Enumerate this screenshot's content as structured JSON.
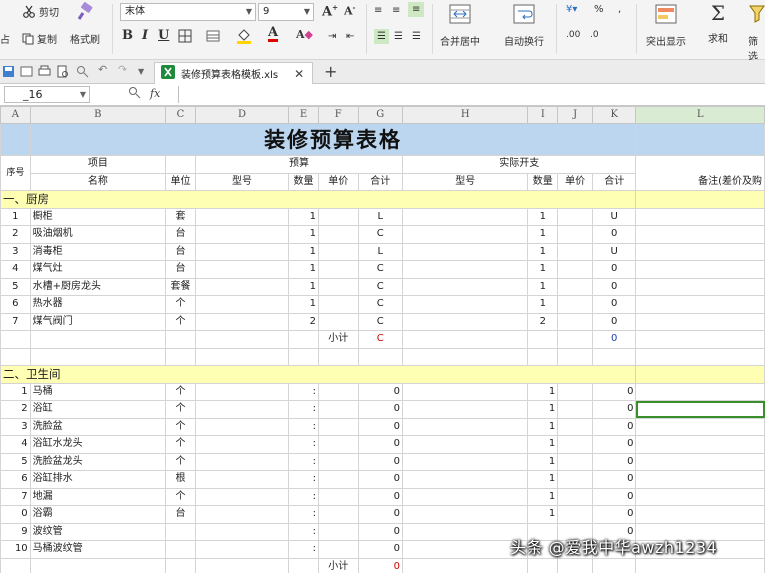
{
  "ribbon": {
    "cut": "剪切",
    "copy": "复制",
    "format_painter": "格式刷",
    "font_name": "末体",
    "font_size": "9",
    "merge_center": "合并居中",
    "wrap_text": "自动换行",
    "highlight": "突出显示",
    "sum": "求和",
    "filter": "筛选",
    "percent": "%"
  },
  "doc_tab": {
    "filename": "装修预算表格模板.xls"
  },
  "formula_bar": {
    "name_box": "_16",
    "fx": "fx"
  },
  "columns": [
    "A",
    "B",
    "C",
    "D",
    "E",
    "F",
    "G",
    "H",
    "I",
    "J",
    "K",
    "L"
  ],
  "sheet": {
    "title": "装修预算表格",
    "header": {
      "index": "序号",
      "item": "项目",
      "item_name": "名称",
      "unit": "单位",
      "budget": "预算",
      "model": "型号",
      "quantity": "数量",
      "unit_price": "单价",
      "total": "合计",
      "actual": "实际开支",
      "actual_model": "型号",
      "actual_qty": "数量",
      "actual_price": "单价",
      "actual_total": "合计",
      "note": "备注(差价及购"
    },
    "section1": {
      "label": "一、厨房",
      "rows": [
        {
          "no": "1",
          "name": "橱柜",
          "unit": "套",
          "qty": "1",
          "total": "L",
          "aqty": "1",
          "atotal": "U"
        },
        {
          "no": "2",
          "name": "吸油烟机",
          "unit": "台",
          "qty": "1",
          "total": "C",
          "aqty": "1",
          "atotal": "0"
        },
        {
          "no": "3",
          "name": "消毒柜",
          "unit": "台",
          "qty": "1",
          "total": "L",
          "aqty": "1",
          "atotal": "U"
        },
        {
          "no": "4",
          "name": "煤气灶",
          "unit": "台",
          "qty": "1",
          "total": "C",
          "aqty": "1",
          "atotal": "0"
        },
        {
          "no": "5",
          "name": "水槽+厨房龙头",
          "unit": "套餐",
          "qty": "1",
          "total": "C",
          "aqty": "1",
          "atotal": "0"
        },
        {
          "no": "6",
          "name": "热水器",
          "unit": "个",
          "qty": "1",
          "total": "C",
          "aqty": "1",
          "atotal": "0"
        },
        {
          "no": "7",
          "name": "煤气阀门",
          "unit": "个",
          "qty": "2",
          "total": "C",
          "aqty": "2",
          "atotal": "0"
        }
      ],
      "subtotal_label": "小计",
      "subtotal_total": "C",
      "subtotal_actual": "0"
    },
    "section2": {
      "label": "二、卫生间",
      "rows": [
        {
          "no": "1",
          "name": "马桶",
          "unit": "个",
          "qty": ":",
          "total": "0",
          "aqty": "1",
          "atotal": "0"
        },
        {
          "no": "2",
          "name": "浴缸",
          "unit": "个",
          "qty": ":",
          "total": "0",
          "aqty": "1",
          "atotal": "0"
        },
        {
          "no": "3",
          "name": "洗脸盆",
          "unit": "个",
          "qty": ":",
          "total": "0",
          "aqty": "1",
          "atotal": "0"
        },
        {
          "no": "4",
          "name": "浴缸水龙头",
          "unit": "个",
          "qty": ":",
          "total": "0",
          "aqty": "1",
          "atotal": "0"
        },
        {
          "no": "5",
          "name": "洗脸盆龙头",
          "unit": "个",
          "qty": ":",
          "total": "0",
          "aqty": "1",
          "atotal": "0"
        },
        {
          "no": "6",
          "name": "浴缸排水",
          "unit": "根",
          "qty": ":",
          "total": "0",
          "aqty": "1",
          "atotal": "0"
        },
        {
          "no": "7",
          "name": "地漏",
          "unit": "个",
          "qty": ":",
          "total": "0",
          "aqty": "1",
          "atotal": "0"
        },
        {
          "no": "0",
          "name": "浴霸",
          "unit": "台",
          "qty": ":",
          "total": "0",
          "aqty": "1",
          "atotal": "0"
        },
        {
          "no": "9",
          "name": "波纹管",
          "unit": "",
          "qty": ":",
          "total": "0",
          "aqty": "",
          "atotal": "0"
        },
        {
          "no": "10",
          "name": "马桶波纹管",
          "unit": "",
          "qty": ":",
          "total": "0",
          "aqty": "",
          "atotal": ""
        }
      ],
      "subtotal_label": "小计",
      "subtotal_total": "0"
    }
  },
  "watermark": "头条 @爱我中华awzh1234",
  "colors": {
    "title_bg": "#bcd6f0",
    "section_bg": "#ffffb4",
    "active_cell": "#3b8e2c"
  }
}
